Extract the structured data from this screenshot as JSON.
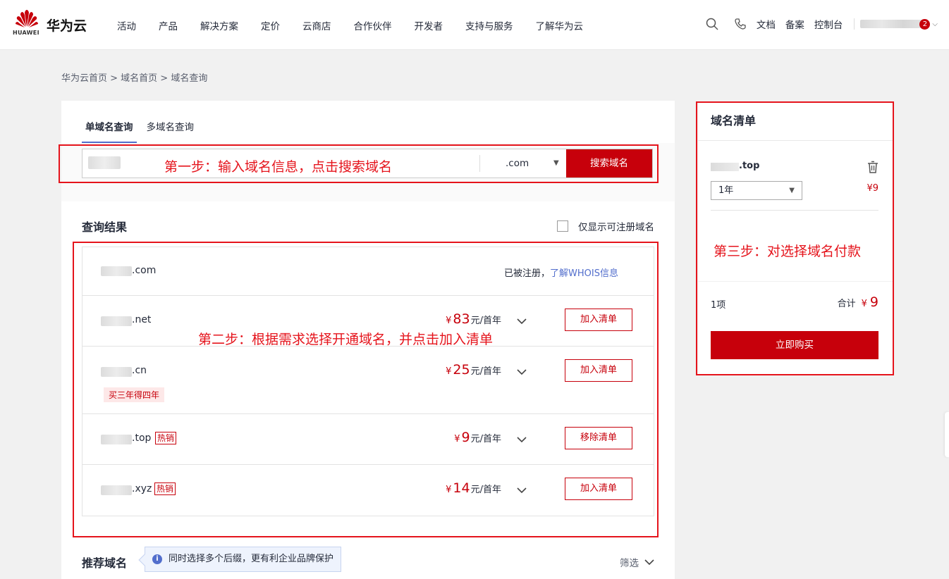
{
  "header": {
    "logo_text": "HUAWEI",
    "brand": "华为云",
    "nav": [
      "活动",
      "产品",
      "解决方案",
      "定价",
      "云商店",
      "合作伙伴",
      "开发者",
      "支持与服务",
      "了解华为云"
    ],
    "links": [
      "文档",
      "备案",
      "控制台"
    ],
    "badge_count": "2"
  },
  "breadcrumb": "华为云首页 > 域名首页 > 域名查询",
  "search": {
    "tabs": [
      "单域名查询",
      "多域名查询"
    ],
    "suffix": ".com",
    "button": "搜索域名"
  },
  "results": {
    "title": "查询结果",
    "only_available_label": "仅显示可注册域名",
    "rows": [
      {
        "ext": ".com",
        "status": "已被注册，",
        "whois": "了解WHOIS信息"
      },
      {
        "ext": ".net",
        "currency": "¥",
        "price": "83",
        "unit": "元/首年",
        "action": "加入清单"
      },
      {
        "ext": ".cn",
        "currency": "¥",
        "price": "25",
        "unit": "元/首年",
        "action": "加入清单",
        "promo": "买三年得四年"
      },
      {
        "ext": ".top",
        "hot": "热销",
        "currency": "¥",
        "price": "9",
        "unit": "元/首年",
        "action": "移除清单"
      },
      {
        "ext": ".xyz",
        "hot": "热销",
        "currency": "¥",
        "price": "14",
        "unit": "元/首年",
        "action": "加入清单"
      }
    ]
  },
  "recommend": {
    "title": "推荐域名",
    "tip": "同时选择多个后缀，更有利企业品牌保护",
    "filter": "筛选"
  },
  "cart": {
    "title": "域名清单",
    "item_ext": ".top",
    "period": "1年",
    "item_price": "¥9",
    "count": "1项",
    "total_label": "合计",
    "total_currency": "¥",
    "total": "9",
    "buy": "立即购买"
  },
  "annotations": {
    "step1": "第一步：输入域名信息，点击搜索域名",
    "step2": "第二步：根据需求选择开通域名，并点击加入清单",
    "step3": "第三步：对选择域名付款"
  },
  "colors": {
    "brand_red": "#c7000b",
    "annotation_red": "#e5141c",
    "link_blue": "#526ecc"
  }
}
